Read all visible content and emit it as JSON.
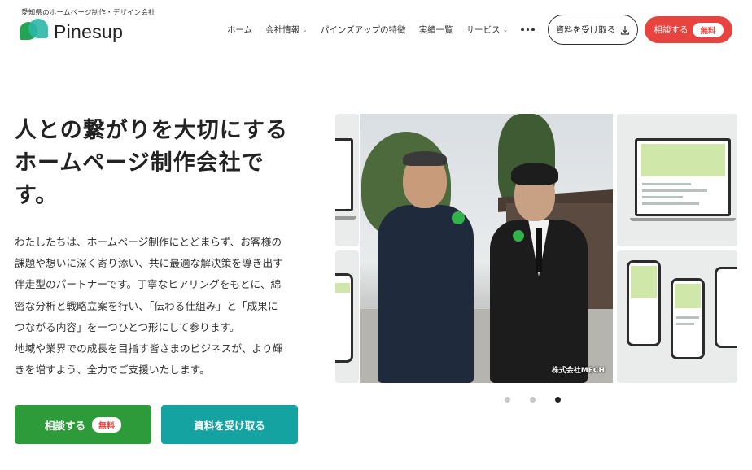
{
  "header": {
    "tagline": "愛知県のホームページ制作・デザイン会社",
    "logo_text": "Pinesup",
    "nav": [
      {
        "label": "ホーム",
        "has_dropdown": false
      },
      {
        "label": "会社情報",
        "has_dropdown": true
      },
      {
        "label": "パインズアップの特徴",
        "has_dropdown": false
      },
      {
        "label": "実績一覧",
        "has_dropdown": false
      },
      {
        "label": "サービス",
        "has_dropdown": true
      }
    ],
    "more_icon": "more-horizontal-icon",
    "doc_button_label": "資料を受け取る",
    "doc_button_icon": "download-icon",
    "consult_button_label": "相談する",
    "consult_badge": "無料"
  },
  "hero": {
    "title_lines": [
      "人との繋がりを大切にする",
      "ホームページ制作会社で",
      "す。"
    ],
    "body_lines": [
      "わたしたちは、ホームページ制作にとどまらず、お客様の",
      "課題や想いに深く寄り添い、共に最適な解決策を導き出す",
      "伴走型のパートナーです。丁寧なヒアリングをもとに、綿",
      "密な分析と戦略立案を行い、「伝わる仕組み」と「成果に",
      "つながる内容」を一つひとつ形にして参ります。",
      "地域や業界での成長を目指す皆さまのビジネスが、より輝",
      "きを増すよう、全力でご支援いたします。"
    ],
    "cta_consult_label": "相談する",
    "cta_consult_badge": "無料",
    "cta_doc_label": "資料を受け取る"
  },
  "slider": {
    "caption": "株式会社MECH",
    "dots": 3,
    "active_dot": 2
  },
  "colors": {
    "consult_red": "#e8433f",
    "green": "#2e9b3a",
    "teal": "#14a3a0",
    "logo_green": "#23a455",
    "logo_teal": "#2bb7a6"
  }
}
